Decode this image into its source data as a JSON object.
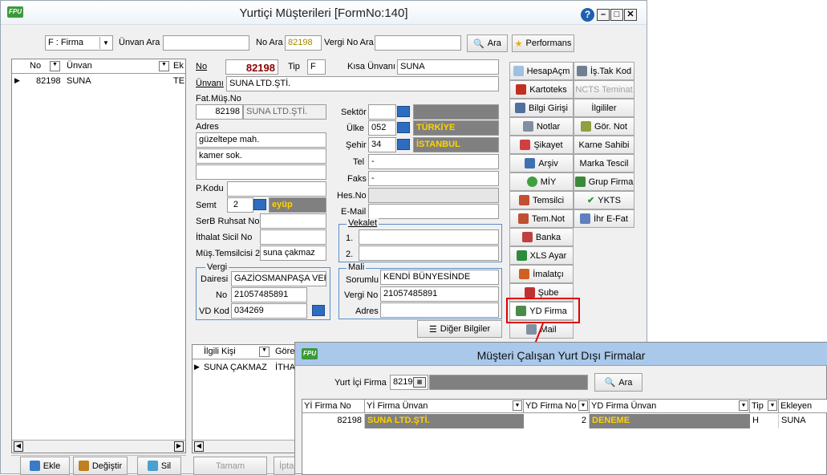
{
  "window": {
    "title": "Yurtiçi Müşterileri [FormNo:140]",
    "logo": "FPU"
  },
  "toolbar": {
    "filter_value": "F : Firma",
    "unvan_label": "Ünvan Ara",
    "unvan_value": "",
    "nosearch_label": "No Ara",
    "nosearch_value": "82198",
    "vergino_label": "Vergi No Ara",
    "vergino_value": "",
    "search_btn": "Ara",
    "perf_btn": "Performans"
  },
  "left_grid": {
    "col_no": "No",
    "col_unvan": "Ünvan",
    "col_ek": "Ek",
    "rows": [
      {
        "no": "82198",
        "unvan": "SUNA",
        "ek": "TE"
      }
    ]
  },
  "form": {
    "no_label": "No",
    "no_value": "82198",
    "tip_label": "Tip",
    "tip_value": "F",
    "kisa_label": "Kısa Ünvanı",
    "kisa_value": "SUNA",
    "unvan_label": "Ünvanı",
    "unvan_value": "SUNA LTD.ŞTİ.",
    "fatmus_label": "Fat.Müş.No",
    "fatmus_no": "82198",
    "fatmus_name": "SUNA LTD.ŞTİ.",
    "adres_label": "Adres",
    "adres1": "güzeltepe mah.",
    "adres2": "kamer sok.",
    "adres3": "",
    "pkodu_label": "P.Kodu",
    "pkodu_value": "",
    "semt_label": "Semt",
    "semt_no": "2",
    "semt_name": "eyüp",
    "serb_label": "SerB Ruhsat No",
    "serb_value": "",
    "ithalat_label": "İthalat Sicil No",
    "ithalat_value": "",
    "mustem_label": "Müş.Temsilcisi 2",
    "mustem_value": "suna çakmaz",
    "vergi_group": "Vergi",
    "vdaire_label": "Dairesi",
    "vdaire_value": "GAZİOSMANPAŞA VERG",
    "vno_label": "No",
    "vno_value": "21057485891",
    "vdkod_label": "VD Kod",
    "vdkod_value": "034269",
    "sektor_label": "Sektör",
    "sektor_value": "",
    "sektor_name": "",
    "ulke_label": "Ülke",
    "ulke_code": "052",
    "ulke_name": "TÜRKİYE",
    "sehir_label": "Şehir",
    "sehir_code": "34",
    "sehir_name": "İSTANBUL",
    "tel_label": "Tel",
    "tel_value": "-",
    "faks_label": "Faks",
    "faks_value": "-",
    "hesno_label": "Hes.No",
    "hesno_value": "",
    "email_label": "E-Mail",
    "email_value": "",
    "vekalet_group": "Vekalet",
    "vek1_label": "1.",
    "vek1_value": "",
    "vek2_label": "2.",
    "vek2_value": "",
    "mali_group": "Mali",
    "sorumlu_label": "Sorumlu",
    "sorumlu_value": "KENDİ BÜNYESİNDE",
    "malivno_label": "Vergi No",
    "malivno_value": "21057485891",
    "maliadres_label": "Adres",
    "maliadres_value": "",
    "diger_btn": "Diğer Bilgiler"
  },
  "contacts": {
    "col1": "İlgili Kişi",
    "col2": "Göre",
    "rows": [
      {
        "name": "SUNA ÇAKMAZ",
        "gorev": "İTHA"
      }
    ]
  },
  "side_buttons": {
    "col1": [
      "HesapAçm",
      "Kartoteks",
      "Bilgi Girişi",
      "Notlar",
      "Şikayet",
      "Arşiv",
      "MİY",
      "Temsilci",
      "Tem.Not",
      "Banka",
      "XLS Ayar",
      "İmalatçı",
      "Şube",
      "YD Firma",
      "Mail"
    ],
    "col2": [
      "İş.Tak Kod",
      "NCTS Teminat",
      "İlgililer",
      "Gör. Not",
      "Karne Sahibi",
      "Marka Tescil",
      "Grup Firma",
      "YKTS",
      "İhr E-Fat"
    ]
  },
  "bottom": {
    "ekle": "Ekle",
    "degistir": "Değiştir",
    "sil": "Sil",
    "tamam": "Tamam",
    "iptal": "İpta"
  },
  "dialog": {
    "title": "Müşteri Çalışan Yurt Dışı Firmalar",
    "yurtici_label": "Yurt İçi Firma",
    "yurtici_value": "8219",
    "search_btn": "Ara",
    "columns": [
      "Yİ Firma No",
      "Yİ Firma Ünvan",
      "YD Firma No",
      "YD Firma Ünvan",
      "Tip",
      "Ekleyen"
    ],
    "rows": [
      {
        "yi_no": "82198",
        "yi_unvan": "SUNA LTD.ŞTİ.",
        "yd_no": "2",
        "yd_unvan": "DENEME",
        "tip": "H",
        "ekleyen": "SUNA"
      }
    ]
  },
  "colors": {
    "highlight": "#e00000",
    "gray_field": "#808080",
    "yellow_text": "#ffd200",
    "dlg_title": "#a9c8ea"
  }
}
